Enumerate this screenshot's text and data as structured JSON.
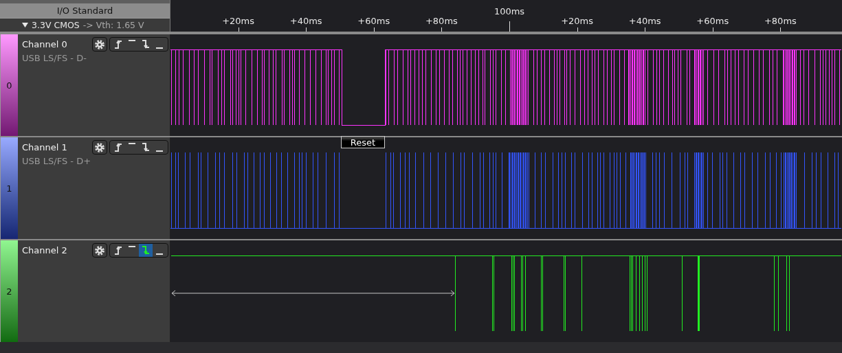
{
  "io_standard": {
    "header": "I/O Standard",
    "value": "3.3V CMOS",
    "threshold": "-> Vth: 1.65 V"
  },
  "timeline": {
    "ticks": [
      {
        "label": "+20ms",
        "kind": "minor"
      },
      {
        "label": "+40ms",
        "kind": "minor"
      },
      {
        "label": "+60ms",
        "kind": "minor"
      },
      {
        "label": "+80ms",
        "kind": "minor"
      },
      {
        "label": "100ms",
        "kind": "major"
      },
      {
        "label": "+20ms",
        "kind": "minor"
      },
      {
        "label": "+40ms",
        "kind": "minor"
      },
      {
        "label": "+60ms",
        "kind": "minor"
      },
      {
        "label": "+80ms",
        "kind": "minor"
      }
    ]
  },
  "channels": [
    {
      "number": "0",
      "name": "Channel 0",
      "description": "USB LS/FS - D-",
      "color": "#ff33ff",
      "kind": "idle_high",
      "triggers": [
        {
          "kind": "rising",
          "selected": false
        },
        {
          "kind": "high",
          "selected": false
        },
        {
          "kind": "falling",
          "selected": false
        },
        {
          "kind": "low",
          "selected": false
        }
      ]
    },
    {
      "number": "1",
      "name": "Channel 1",
      "description": "USB LS/FS - D+",
      "color": "#3355ff",
      "kind": "idle_low",
      "triggers": [
        {
          "kind": "rising",
          "selected": false
        },
        {
          "kind": "high",
          "selected": false
        },
        {
          "kind": "falling",
          "selected": false
        },
        {
          "kind": "low",
          "selected": false
        }
      ]
    },
    {
      "number": "2",
      "name": "Channel 2",
      "color": "#22ee22",
      "kind": "sparse",
      "triggers": [
        {
          "kind": "rising",
          "selected": false
        },
        {
          "kind": "high",
          "selected": false
        },
        {
          "kind": "falling",
          "selected": true
        },
        {
          "kind": "low",
          "selected": false
        }
      ]
    }
  ],
  "reset_button": "Reset"
}
